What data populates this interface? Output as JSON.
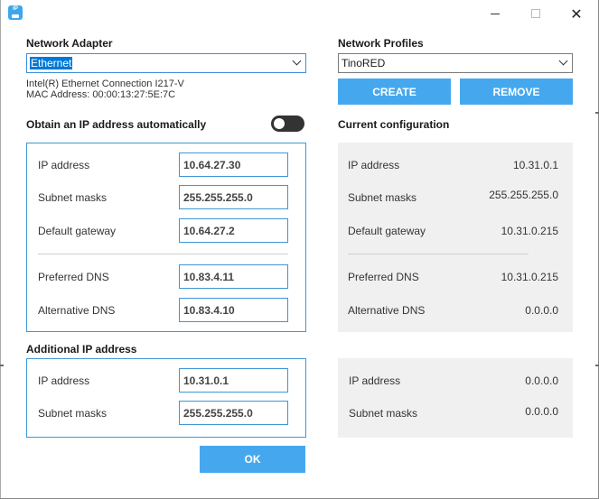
{
  "window": {
    "app_icon": "network-app-icon",
    "controls": {
      "minimize": "minimize-icon",
      "maximize": "maximize-icon",
      "close": "close-icon"
    },
    "close_glyph": "✕"
  },
  "adapter": {
    "heading": "Network Adapter",
    "selected": "Ethernet",
    "description": "Intel(R) Ethernet Connection I217-V",
    "mac": "MAC Address: 00:00:13:27:5E:7C"
  },
  "profiles": {
    "heading": "Network Profiles",
    "selected": "TinoRED",
    "create_label": "CREATE",
    "remove_label": "REMOVE"
  },
  "auto_ip": {
    "label": "Obtain an IP address automatically",
    "enabled": false
  },
  "ip_settings": {
    "ip_label": "IP address",
    "ip_value": "10.64.27.30",
    "mask_label": "Subnet masks",
    "mask_value": "255.255.255.0",
    "gateway_label": "Default gateway",
    "gateway_value": "10.64.27.2",
    "dns1_label": "Preferred DNS",
    "dns1_value": "10.83.4.11",
    "dns2_label": "Alternative DNS",
    "dns2_value": "10.83.4.10"
  },
  "current": {
    "heading": "Current configuration",
    "ip_label": "IP address",
    "ip_value": "10.31.0.1",
    "mask_label": "Subnet masks",
    "mask_value": "255.255.255.0",
    "gateway_label": "Default gateway",
    "gateway_value": "10.31.0.215",
    "dns1_label": "Preferred DNS",
    "dns1_value": "10.31.0.215",
    "dns2_label": "Alternative DNS",
    "dns2_value": "0.0.0.0"
  },
  "additional": {
    "heading": "Additional IP address",
    "ip_label": "IP address",
    "ip_value": "10.31.0.1",
    "mask_label": "Subnet masks",
    "mask_value": "255.255.255.0"
  },
  "additional_current": {
    "ip_label": "IP address",
    "ip_value": "0.0.0.0",
    "mask_label": "Subnet masks",
    "mask_value": "0.0.0.0"
  },
  "ok_label": "OK",
  "colors": {
    "accent": "#45a8ee",
    "field_border": "#3e97d6",
    "panel_gray": "#f0f0f0"
  }
}
